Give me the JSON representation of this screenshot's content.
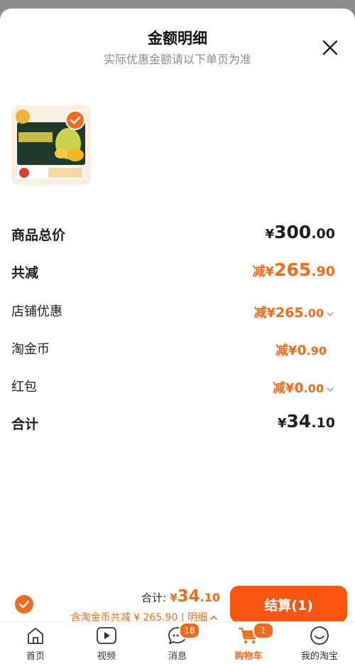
{
  "header": {
    "title": "金额明细",
    "subtitle": "实际优惠金额请以下单页为准"
  },
  "breakdown": {
    "goods_total": {
      "label": "商品总价",
      "currency": "¥",
      "int": "300",
      "dec": ".00"
    },
    "total_reduce": {
      "label": "共减",
      "prefix": "减¥",
      "int": "265",
      "dec": ".90"
    },
    "shop_discount": {
      "label": "店铺优惠",
      "prefix": "减¥",
      "int": "265",
      "dec": ".00"
    },
    "taojinbi": {
      "label": "淘金币",
      "prefix": "减¥",
      "int": "0",
      "dec": ".90"
    },
    "red_packet": {
      "label": "红包",
      "prefix": "减¥",
      "int": "0",
      "dec": ".00"
    },
    "sum": {
      "label": "合计",
      "currency": "¥",
      "int": "34",
      "dec": ".10"
    }
  },
  "checkout": {
    "total_label": "合计:",
    "currency": "¥",
    "int": "34",
    "dec": ".10",
    "coin_text": "含淘金币共减 ¥ 265.90",
    "separator": " | ",
    "detail_label": "明细",
    "button_label": "结算(1)"
  },
  "tabbar": {
    "items": [
      {
        "label": "首页",
        "icon": "home-icon"
      },
      {
        "label": "视频",
        "icon": "video-icon"
      },
      {
        "label": "消息",
        "icon": "message-icon",
        "badge": "18"
      },
      {
        "label": "购物车",
        "icon": "cart-icon",
        "badge": "1",
        "active": true
      },
      {
        "label": "我的淘宝",
        "icon": "profile-icon"
      }
    ]
  },
  "colors": {
    "accent": "#f26a1b",
    "button": "#f9570f",
    "text": "#1f1f1f",
    "muted": "#8a8a8a"
  }
}
